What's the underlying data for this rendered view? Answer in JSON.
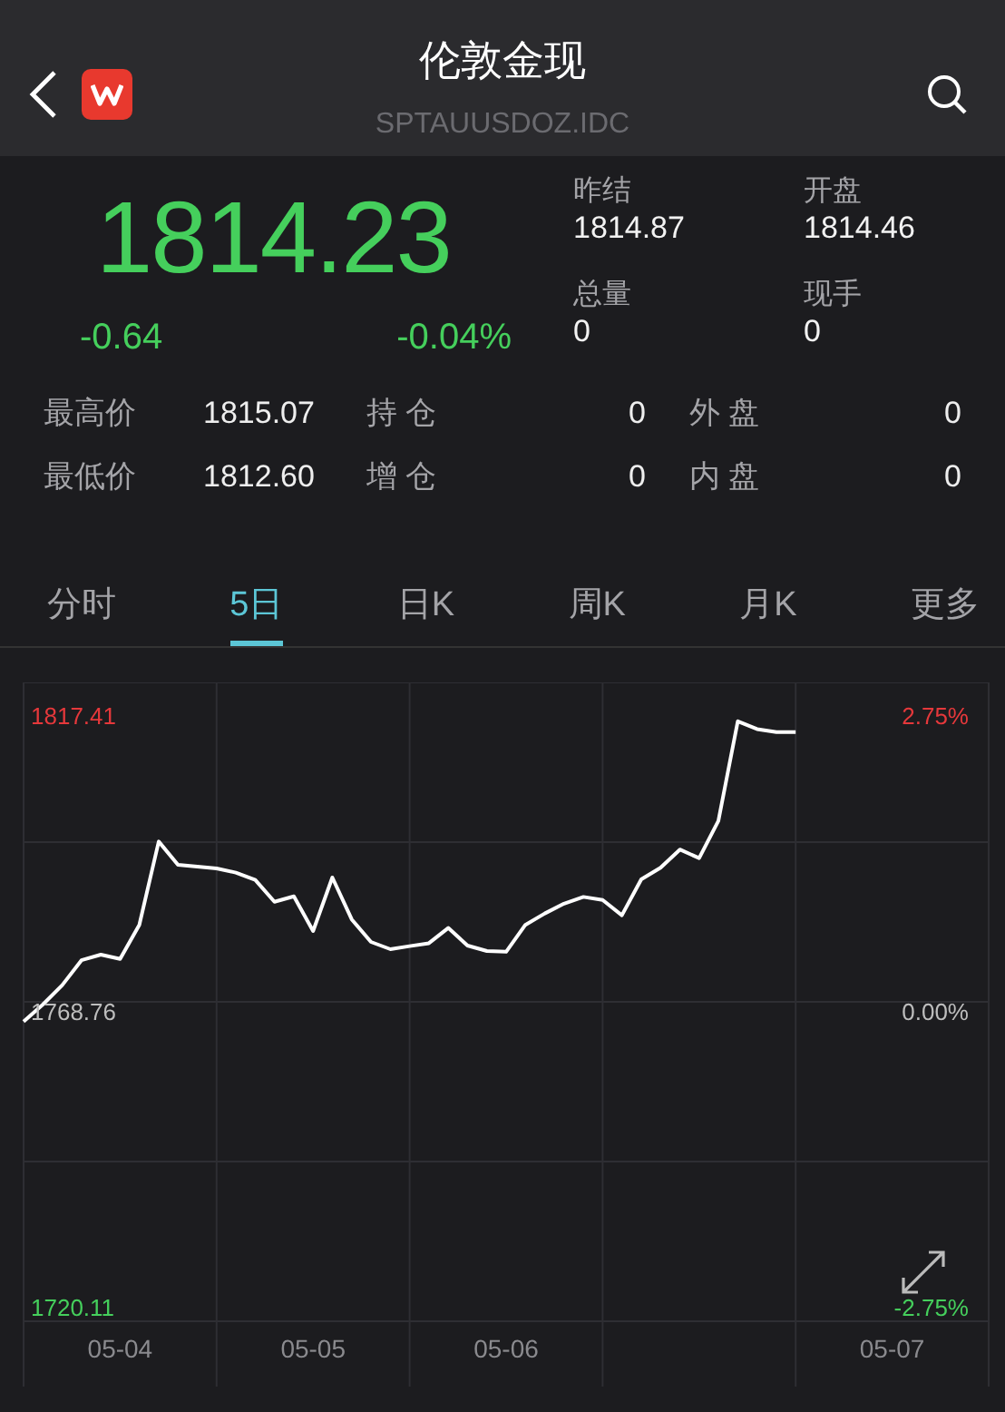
{
  "header": {
    "title": "伦敦金现",
    "code": "SPTAUUSDOZ.IDC"
  },
  "quote": {
    "price": "1814.23",
    "change": "-0.64",
    "change_percent": "-0.04%"
  },
  "summary": [
    {
      "label": "昨结",
      "value": "1814.87"
    },
    {
      "label": "开盘",
      "value": "1814.46"
    },
    {
      "label": "总量",
      "value": "0"
    },
    {
      "label": "现手",
      "value": "0"
    }
  ],
  "stats": [
    [
      {
        "label": "最高价",
        "value": "1815.07"
      },
      {
        "label": "持 仓",
        "value": "0"
      },
      {
        "label": "外 盘",
        "value": "0"
      }
    ],
    [
      {
        "label": "最低价",
        "value": "1812.60"
      },
      {
        "label": "增 仓",
        "value": "0"
      },
      {
        "label": "内 盘",
        "value": "0"
      }
    ]
  ],
  "tabs": [
    {
      "label": "分时",
      "selected": false
    },
    {
      "label": "5日",
      "selected": true
    },
    {
      "label": "日K",
      "selected": false
    },
    {
      "label": "周K",
      "selected": false
    },
    {
      "label": "月K",
      "selected": false
    },
    {
      "label": "更多",
      "selected": false
    }
  ],
  "chart": {
    "axis_levels": [
      {
        "price": "1817.41",
        "change": "2.75%",
        "color": "#e5383b"
      },
      {
        "price": "1768.76",
        "change": "0.00%",
        "color": "#bdbdbd"
      },
      {
        "price": "1720.11",
        "change": "-2.75%",
        "color": "#45cf5c"
      }
    ],
    "chart_data": {
      "type": "line",
      "grid": true,
      "ylim": [
        1706.98,
        1822.78
      ],
      "yticks": [
        1817.41,
        1768.76,
        1720.11
      ],
      "categories": [
        null,
        null,
        null,
        null,
        null,
        "05-04",
        null,
        null,
        null,
        null,
        null,
        null,
        null,
        null,
        null,
        "05-05",
        null,
        null,
        null,
        null,
        null,
        null,
        null,
        null,
        null,
        "05-06",
        null,
        null,
        null,
        null,
        null,
        null,
        null,
        null,
        null,
        null,
        null,
        null,
        null,
        null,
        null,
        null,
        null,
        null,
        null,
        "05-07",
        null,
        null,
        null,
        null
      ],
      "series": [
        {
          "color": "#ffffff",
          "values": [
            1767.0,
            1769.8,
            1773.0,
            1777.1,
            1778.0,
            1777.3,
            1782.9,
            1796.6,
            1792.8,
            1792.5,
            1792.2,
            1791.5,
            1790.3,
            1786.7,
            1787.6,
            1781.9,
            1790.7,
            1783.8,
            1780.1,
            1778.9,
            1779.4,
            1779.9,
            1782.4,
            1779.5,
            1778.6,
            1778.5,
            1782.9,
            1784.8,
            1786.4,
            1787.5,
            1787.0,
            1784.5,
            1790.4,
            1792.3,
            1795.3,
            1793.9,
            1800.0,
            1816.4,
            1815.1,
            1814.6,
            1814.6,
            null,
            null,
            null,
            null,
            null,
            null,
            null,
            null,
            null
          ]
        }
      ]
    }
  }
}
